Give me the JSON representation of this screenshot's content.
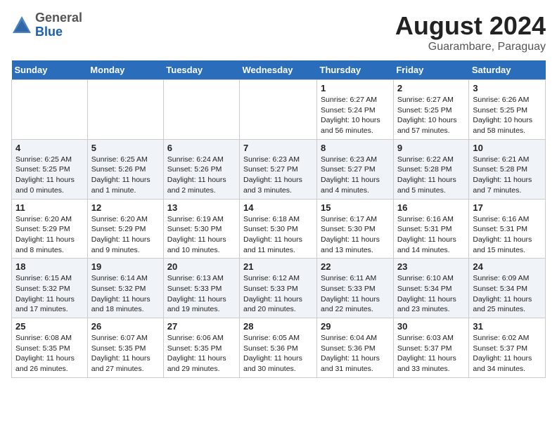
{
  "header": {
    "logo": {
      "general": "General",
      "blue": "Blue"
    },
    "title": "August 2024",
    "location": "Guarambare, Paraguay"
  },
  "weekdays": [
    "Sunday",
    "Monday",
    "Tuesday",
    "Wednesday",
    "Thursday",
    "Friday",
    "Saturday"
  ],
  "weeks": [
    [
      {
        "day": "",
        "sunrise": "",
        "sunset": "",
        "daylight": ""
      },
      {
        "day": "",
        "sunrise": "",
        "sunset": "",
        "daylight": ""
      },
      {
        "day": "",
        "sunrise": "",
        "sunset": "",
        "daylight": ""
      },
      {
        "day": "",
        "sunrise": "",
        "sunset": "",
        "daylight": ""
      },
      {
        "day": "1",
        "sunrise": "6:27 AM",
        "sunset": "5:24 PM",
        "daylight": "10 hours and 56 minutes."
      },
      {
        "day": "2",
        "sunrise": "6:27 AM",
        "sunset": "5:25 PM",
        "daylight": "10 hours and 57 minutes."
      },
      {
        "day": "3",
        "sunrise": "6:26 AM",
        "sunset": "5:25 PM",
        "daylight": "10 hours and 58 minutes."
      }
    ],
    [
      {
        "day": "4",
        "sunrise": "6:25 AM",
        "sunset": "5:25 PM",
        "daylight": "11 hours and 0 minutes."
      },
      {
        "day": "5",
        "sunrise": "6:25 AM",
        "sunset": "5:26 PM",
        "daylight": "11 hours and 1 minute."
      },
      {
        "day": "6",
        "sunrise": "6:24 AM",
        "sunset": "5:26 PM",
        "daylight": "11 hours and 2 minutes."
      },
      {
        "day": "7",
        "sunrise": "6:23 AM",
        "sunset": "5:27 PM",
        "daylight": "11 hours and 3 minutes."
      },
      {
        "day": "8",
        "sunrise": "6:23 AM",
        "sunset": "5:27 PM",
        "daylight": "11 hours and 4 minutes."
      },
      {
        "day": "9",
        "sunrise": "6:22 AM",
        "sunset": "5:28 PM",
        "daylight": "11 hours and 5 minutes."
      },
      {
        "day": "10",
        "sunrise": "6:21 AM",
        "sunset": "5:28 PM",
        "daylight": "11 hours and 7 minutes."
      }
    ],
    [
      {
        "day": "11",
        "sunrise": "6:20 AM",
        "sunset": "5:29 PM",
        "daylight": "11 hours and 8 minutes."
      },
      {
        "day": "12",
        "sunrise": "6:20 AM",
        "sunset": "5:29 PM",
        "daylight": "11 hours and 9 minutes."
      },
      {
        "day": "13",
        "sunrise": "6:19 AM",
        "sunset": "5:30 PM",
        "daylight": "11 hours and 10 minutes."
      },
      {
        "day": "14",
        "sunrise": "6:18 AM",
        "sunset": "5:30 PM",
        "daylight": "11 hours and 11 minutes."
      },
      {
        "day": "15",
        "sunrise": "6:17 AM",
        "sunset": "5:30 PM",
        "daylight": "11 hours and 13 minutes."
      },
      {
        "day": "16",
        "sunrise": "6:16 AM",
        "sunset": "5:31 PM",
        "daylight": "11 hours and 14 minutes."
      },
      {
        "day": "17",
        "sunrise": "6:16 AM",
        "sunset": "5:31 PM",
        "daylight": "11 hours and 15 minutes."
      }
    ],
    [
      {
        "day": "18",
        "sunrise": "6:15 AM",
        "sunset": "5:32 PM",
        "daylight": "11 hours and 17 minutes."
      },
      {
        "day": "19",
        "sunrise": "6:14 AM",
        "sunset": "5:32 PM",
        "daylight": "11 hours and 18 minutes."
      },
      {
        "day": "20",
        "sunrise": "6:13 AM",
        "sunset": "5:33 PM",
        "daylight": "11 hours and 19 minutes."
      },
      {
        "day": "21",
        "sunrise": "6:12 AM",
        "sunset": "5:33 PM",
        "daylight": "11 hours and 20 minutes."
      },
      {
        "day": "22",
        "sunrise": "6:11 AM",
        "sunset": "5:33 PM",
        "daylight": "11 hours and 22 minutes."
      },
      {
        "day": "23",
        "sunrise": "6:10 AM",
        "sunset": "5:34 PM",
        "daylight": "11 hours and 23 minutes."
      },
      {
        "day": "24",
        "sunrise": "6:09 AM",
        "sunset": "5:34 PM",
        "daylight": "11 hours and 25 minutes."
      }
    ],
    [
      {
        "day": "25",
        "sunrise": "6:08 AM",
        "sunset": "5:35 PM",
        "daylight": "11 hours and 26 minutes."
      },
      {
        "day": "26",
        "sunrise": "6:07 AM",
        "sunset": "5:35 PM",
        "daylight": "11 hours and 27 minutes."
      },
      {
        "day": "27",
        "sunrise": "6:06 AM",
        "sunset": "5:35 PM",
        "daylight": "11 hours and 29 minutes."
      },
      {
        "day": "28",
        "sunrise": "6:05 AM",
        "sunset": "5:36 PM",
        "daylight": "11 hours and 30 minutes."
      },
      {
        "day": "29",
        "sunrise": "6:04 AM",
        "sunset": "5:36 PM",
        "daylight": "11 hours and 31 minutes."
      },
      {
        "day": "30",
        "sunrise": "6:03 AM",
        "sunset": "5:37 PM",
        "daylight": "11 hours and 33 minutes."
      },
      {
        "day": "31",
        "sunrise": "6:02 AM",
        "sunset": "5:37 PM",
        "daylight": "11 hours and 34 minutes."
      }
    ]
  ]
}
